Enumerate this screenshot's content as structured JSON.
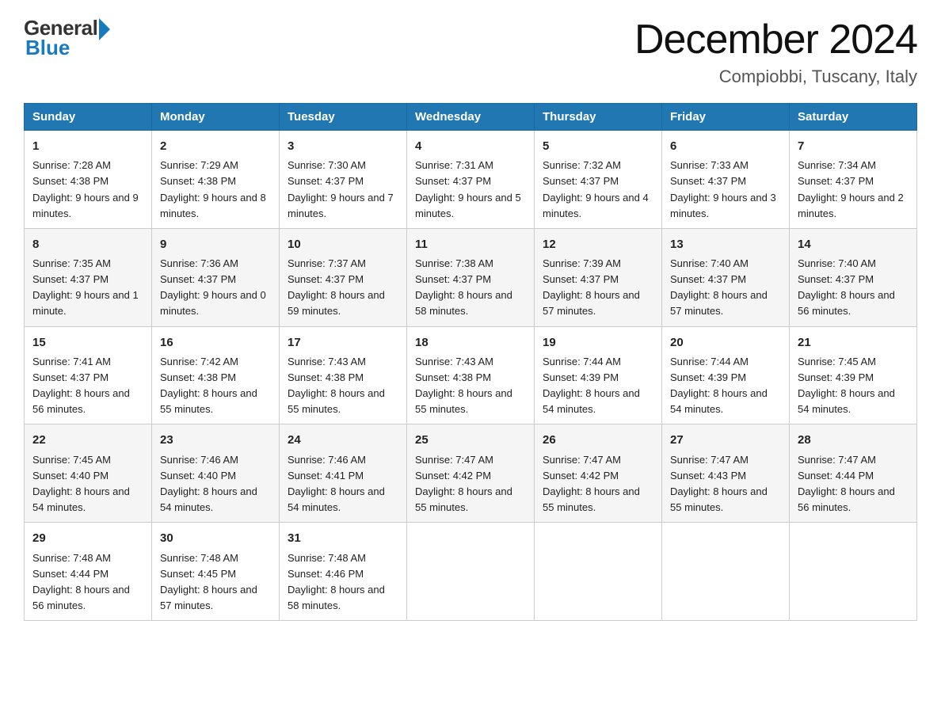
{
  "header": {
    "logo_general": "General",
    "logo_blue": "Blue",
    "month_title": "December 2024",
    "location": "Compiobbi, Tuscany, Italy"
  },
  "days_of_week": [
    "Sunday",
    "Monday",
    "Tuesday",
    "Wednesday",
    "Thursday",
    "Friday",
    "Saturday"
  ],
  "weeks": [
    [
      {
        "day": "1",
        "sunrise": "7:28 AM",
        "sunset": "4:38 PM",
        "daylight": "9 hours and 9 minutes."
      },
      {
        "day": "2",
        "sunrise": "7:29 AM",
        "sunset": "4:38 PM",
        "daylight": "9 hours and 8 minutes."
      },
      {
        "day": "3",
        "sunrise": "7:30 AM",
        "sunset": "4:37 PM",
        "daylight": "9 hours and 7 minutes."
      },
      {
        "day": "4",
        "sunrise": "7:31 AM",
        "sunset": "4:37 PM",
        "daylight": "9 hours and 5 minutes."
      },
      {
        "day": "5",
        "sunrise": "7:32 AM",
        "sunset": "4:37 PM",
        "daylight": "9 hours and 4 minutes."
      },
      {
        "day": "6",
        "sunrise": "7:33 AM",
        "sunset": "4:37 PM",
        "daylight": "9 hours and 3 minutes."
      },
      {
        "day": "7",
        "sunrise": "7:34 AM",
        "sunset": "4:37 PM",
        "daylight": "9 hours and 2 minutes."
      }
    ],
    [
      {
        "day": "8",
        "sunrise": "7:35 AM",
        "sunset": "4:37 PM",
        "daylight": "9 hours and 1 minute."
      },
      {
        "day": "9",
        "sunrise": "7:36 AM",
        "sunset": "4:37 PM",
        "daylight": "9 hours and 0 minutes."
      },
      {
        "day": "10",
        "sunrise": "7:37 AM",
        "sunset": "4:37 PM",
        "daylight": "8 hours and 59 minutes."
      },
      {
        "day": "11",
        "sunrise": "7:38 AM",
        "sunset": "4:37 PM",
        "daylight": "8 hours and 58 minutes."
      },
      {
        "day": "12",
        "sunrise": "7:39 AM",
        "sunset": "4:37 PM",
        "daylight": "8 hours and 57 minutes."
      },
      {
        "day": "13",
        "sunrise": "7:40 AM",
        "sunset": "4:37 PM",
        "daylight": "8 hours and 57 minutes."
      },
      {
        "day": "14",
        "sunrise": "7:40 AM",
        "sunset": "4:37 PM",
        "daylight": "8 hours and 56 minutes."
      }
    ],
    [
      {
        "day": "15",
        "sunrise": "7:41 AM",
        "sunset": "4:37 PM",
        "daylight": "8 hours and 56 minutes."
      },
      {
        "day": "16",
        "sunrise": "7:42 AM",
        "sunset": "4:38 PM",
        "daylight": "8 hours and 55 minutes."
      },
      {
        "day": "17",
        "sunrise": "7:43 AM",
        "sunset": "4:38 PM",
        "daylight": "8 hours and 55 minutes."
      },
      {
        "day": "18",
        "sunrise": "7:43 AM",
        "sunset": "4:38 PM",
        "daylight": "8 hours and 55 minutes."
      },
      {
        "day": "19",
        "sunrise": "7:44 AM",
        "sunset": "4:39 PM",
        "daylight": "8 hours and 54 minutes."
      },
      {
        "day": "20",
        "sunrise": "7:44 AM",
        "sunset": "4:39 PM",
        "daylight": "8 hours and 54 minutes."
      },
      {
        "day": "21",
        "sunrise": "7:45 AM",
        "sunset": "4:39 PM",
        "daylight": "8 hours and 54 minutes."
      }
    ],
    [
      {
        "day": "22",
        "sunrise": "7:45 AM",
        "sunset": "4:40 PM",
        "daylight": "8 hours and 54 minutes."
      },
      {
        "day": "23",
        "sunrise": "7:46 AM",
        "sunset": "4:40 PM",
        "daylight": "8 hours and 54 minutes."
      },
      {
        "day": "24",
        "sunrise": "7:46 AM",
        "sunset": "4:41 PM",
        "daylight": "8 hours and 54 minutes."
      },
      {
        "day": "25",
        "sunrise": "7:47 AM",
        "sunset": "4:42 PM",
        "daylight": "8 hours and 55 minutes."
      },
      {
        "day": "26",
        "sunrise": "7:47 AM",
        "sunset": "4:42 PM",
        "daylight": "8 hours and 55 minutes."
      },
      {
        "day": "27",
        "sunrise": "7:47 AM",
        "sunset": "4:43 PM",
        "daylight": "8 hours and 55 minutes."
      },
      {
        "day": "28",
        "sunrise": "7:47 AM",
        "sunset": "4:44 PM",
        "daylight": "8 hours and 56 minutes."
      }
    ],
    [
      {
        "day": "29",
        "sunrise": "7:48 AM",
        "sunset": "4:44 PM",
        "daylight": "8 hours and 56 minutes."
      },
      {
        "day": "30",
        "sunrise": "7:48 AM",
        "sunset": "4:45 PM",
        "daylight": "8 hours and 57 minutes."
      },
      {
        "day": "31",
        "sunrise": "7:48 AM",
        "sunset": "4:46 PM",
        "daylight": "8 hours and 58 minutes."
      },
      null,
      null,
      null,
      null
    ]
  ],
  "labels": {
    "sunrise": "Sunrise:",
    "sunset": "Sunset:",
    "daylight": "Daylight:"
  }
}
